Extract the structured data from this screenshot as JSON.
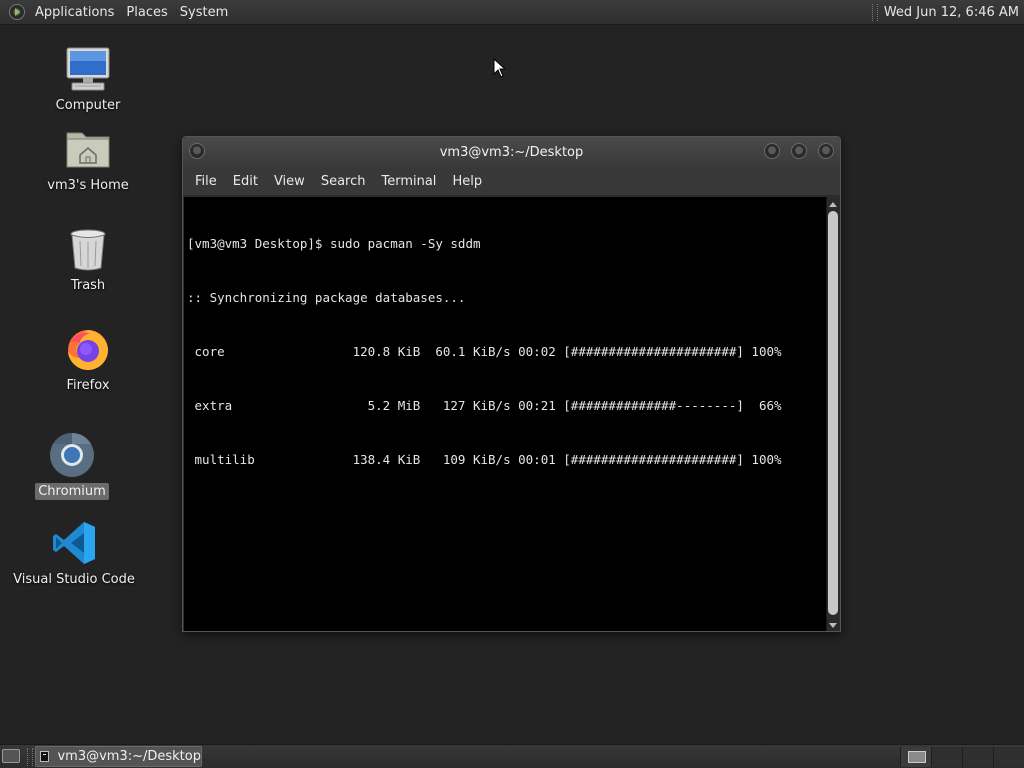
{
  "top_panel": {
    "menus": [
      "Applications",
      "Places",
      "System"
    ],
    "clock": "Wed Jun 12,  6:46 AM"
  },
  "desktop_icons": [
    {
      "label": "Computer",
      "icon": "computer-icon"
    },
    {
      "label": "vm3's Home",
      "icon": "home-folder-icon"
    },
    {
      "label": "Trash",
      "icon": "trash-icon"
    },
    {
      "label": "Firefox",
      "icon": "firefox-icon"
    },
    {
      "label": "Chromium",
      "icon": "chromium-icon",
      "selected": true
    },
    {
      "label": "Visual Studio Code",
      "icon": "vscode-icon"
    }
  ],
  "terminal": {
    "title": "vm3@vm3:~/Desktop",
    "menus": [
      "File",
      "Edit",
      "View",
      "Search",
      "Terminal",
      "Help"
    ],
    "lines": [
      "[vm3@vm3 Desktop]$ sudo pacman -Sy sddm",
      ":: Synchronizing package databases...",
      " core                 120.8 KiB  60.1 KiB/s 00:02 [######################] 100%",
      " extra                  5.2 MiB   127 KiB/s 00:21 [##############--------]  66%",
      " multilib             138.4 KiB   109 KiB/s 00:01 [######################] 100%"
    ]
  },
  "bottom_panel": {
    "task_label": "vm3@vm3:~/Desktop",
    "workspaces": 4,
    "active_workspace": 1
  },
  "colors": {
    "desktop_bg": "#232323",
    "panel_bg": "#333333",
    "terminal_bg": "#000000",
    "terminal_fg": "#e5e5e5"
  }
}
